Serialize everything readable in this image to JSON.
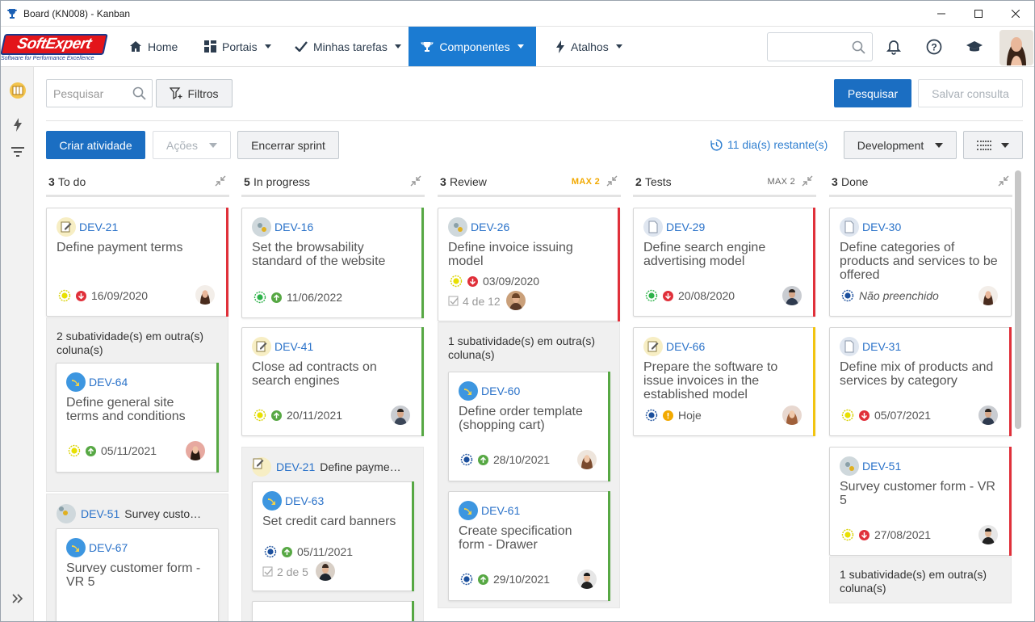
{
  "window": {
    "title": "Board (KN008) - Kanban"
  },
  "logo": {
    "brand_a": "Soft",
    "brand_b": "Expert",
    "tagline": "Software for Performance Excellence"
  },
  "nav": {
    "home": "Home",
    "portals": "Portais",
    "tasks": "Minhas tarefas",
    "components": "Componentes",
    "shortcuts": "Atalhos"
  },
  "toolbar": {
    "search_placeholder": "Pesquisar",
    "filters": "Filtros",
    "search_button": "Pesquisar",
    "save_query": "Salvar consulta",
    "create_activity": "Criar atividade",
    "actions": "Ações",
    "close_sprint": "Encerrar sprint",
    "remaining": "11 dia(s) restante(s)",
    "team": "Development"
  },
  "colors": {
    "accent": "#1b6ec2",
    "nav_active": "#1b7bd2",
    "link": "#2a72c9",
    "bar_red": "#e0303a",
    "bar_green": "#57a844",
    "bar_yellow": "#f2c40f"
  },
  "columns": [
    {
      "count": "3",
      "name": "To do",
      "max": ""
    },
    {
      "count": "5",
      "name": "In progress",
      "max": ""
    },
    {
      "count": "3",
      "name": "Review",
      "max": "MAX 2"
    },
    {
      "count": "2",
      "name": "Tests",
      "max": "MAX 2"
    },
    {
      "count": "3",
      "name": "Done",
      "max": ""
    }
  ],
  "cards": {
    "c1": {
      "key": "DEV-21",
      "title": "Define payment terms",
      "date": "16/09/2020"
    },
    "c1_group": {
      "text": "2 subatividade(s) em outra(s) coluna(s)"
    },
    "c1_sub": {
      "key": "DEV-64",
      "title": "Define general site terms and conditions",
      "date": "05/11/2021"
    },
    "c1_parent2": {
      "key": "DEV-51",
      "label": "Survey custo…"
    },
    "c1_sub2": {
      "key": "DEV-67",
      "title": "Survey customer form - VR 5"
    },
    "c2": {
      "key": "DEV-16",
      "title": "Set the browsability standard of the website",
      "date": "11/06/2022"
    },
    "c2b": {
      "key": "DEV-41",
      "title": "Close ad contracts on search engines",
      "date": "20/11/2021"
    },
    "c2_parent": {
      "key": "DEV-21",
      "label": "Define payme…"
    },
    "c2_sub": {
      "key": "DEV-63",
      "title": "Set credit card banners",
      "date": "05/11/2021",
      "progress": "2 de 5"
    },
    "c3": {
      "key": "DEV-26",
      "title": "Define invoice issuing model",
      "date": "03/09/2020",
      "progress": "4 de 12"
    },
    "c3_group": {
      "text": "1 subatividade(s) em outra(s) coluna(s)"
    },
    "c3_sub": {
      "key": "DEV-60",
      "title": "Define order template (shopping cart)",
      "date": "28/10/2021"
    },
    "c3_sub2": {
      "key": "DEV-61",
      "title": "Create specification form - Drawer",
      "date": "29/10/2021"
    },
    "c4": {
      "key": "DEV-29",
      "title": "Define search engine advertising model",
      "date": "20/08/2020"
    },
    "c4b": {
      "key": "DEV-66",
      "title": "Prepare the software to issue invoices in the established model",
      "date": "Hoje"
    },
    "c5": {
      "key": "DEV-30",
      "title": "Define categories of products and services to be offered",
      "date": "Não preenchido"
    },
    "c5b": {
      "key": "DEV-31",
      "title": "Define mix of products and services by category",
      "date": "05/07/2021"
    },
    "c5c": {
      "key": "DEV-51",
      "title": "Survey customer form - VR 5",
      "date": "27/08/2021"
    },
    "c5_group": {
      "text": "1 subatividade(s) em outra(s) coluna(s)"
    }
  }
}
